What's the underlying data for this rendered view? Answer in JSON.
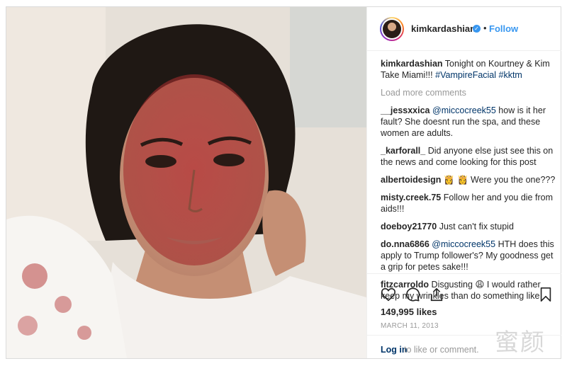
{
  "post": {
    "username": "kimkardashian",
    "follow_label": "Follow",
    "separator": "•",
    "verified_mark": "✓",
    "caption": {
      "user": "kimkardashian",
      "text": "Tonight on Kourtney & Kim Take Miami!!!",
      "hashtags": "#VampireFacial #kktm"
    },
    "load_more": "Load more comments",
    "comments": [
      {
        "user": "__jessxxica",
        "mention": "@miccocreek55",
        "text": "how is it her fault? She doesnt run the spa, and these women are adults."
      },
      {
        "user": "_karforall_",
        "mention": "",
        "text": "Did anyone else just see this on the news and come looking for this post"
      },
      {
        "user": "albertoidesign",
        "mention": "",
        "text": "👸 👸  Were you the one???"
      },
      {
        "user": "misty.creek.75",
        "mention": "",
        "text": "Follow her and you die from aids!!!"
      },
      {
        "user": "doeboy21770",
        "mention": "",
        "text": "Just can't fix stupid"
      },
      {
        "user": "do.nna6866",
        "mention": "@miccocreek55",
        "text": "HTH does this apply to Trump follower's? My goodness get a grip for petes sake!!!"
      },
      {
        "user": "fitzcarroldo",
        "mention": "",
        "text": "Disgusting 😩 I would rather keep my wrinkles than do something like"
      }
    ],
    "likes": "149,995 likes",
    "date": "MARCH 11, 2013",
    "login_link": "Log in",
    "login_rest": "to like or comment."
  },
  "icons": {
    "like": "heart-icon",
    "comment": "comment-icon",
    "share": "share-icon",
    "save": "bookmark-icon"
  },
  "watermark": "蜜颜",
  "colors": {
    "link_blue": "#3897f0",
    "username_dark": "#262626",
    "muted": "#999999",
    "mention_blue": "#003569"
  }
}
